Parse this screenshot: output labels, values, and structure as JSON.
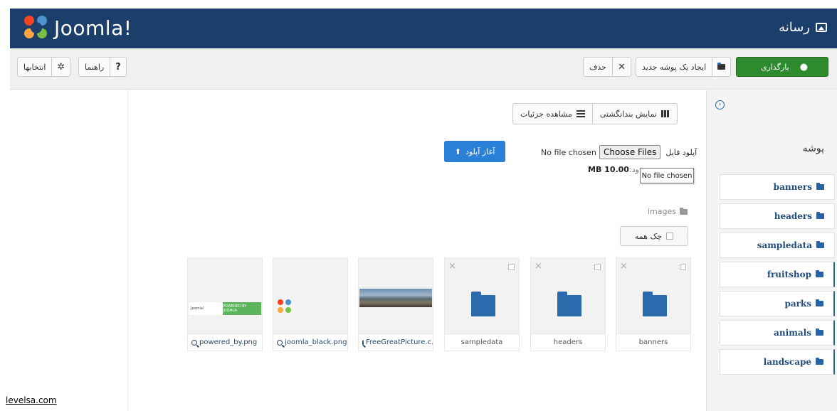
{
  "header": {
    "brand": "Joomla!",
    "page_title": "رسانه"
  },
  "toolbar": {
    "upload_label": "بارگذاری",
    "new_folder_label": "ایجاد یک پوشه جدید",
    "delete_label": "حذف",
    "help_label": "راهنما",
    "options_label": "انتخابها"
  },
  "sidebar": {
    "title": "پوشه",
    "folders": [
      {
        "label": "banners",
        "child": false
      },
      {
        "label": "headers",
        "child": false
      },
      {
        "label": "sampledata",
        "child": false
      },
      {
        "label": "fruitshop",
        "child": true
      },
      {
        "label": "parks",
        "child": true
      },
      {
        "label": "animals",
        "child": true
      },
      {
        "label": "landscape",
        "child": true
      }
    ]
  },
  "views": {
    "thumbnail_label": "نمایش بندانگشتی",
    "detail_label": "مشاهده جزئیات"
  },
  "upload": {
    "file_label": "آپلود فایل",
    "choose_button": "Choose Files",
    "no_file": "No file chosen",
    "max_size": "MB 10.00",
    "max_size_label": "ود:",
    "tooltip": "No file chosen",
    "start_button": "آغاز آپلود"
  },
  "browser": {
    "breadcrumb": "images",
    "check_all": "چک همه",
    "items": [
      {
        "type": "folder",
        "name": "banners"
      },
      {
        "type": "folder",
        "name": "headers"
      },
      {
        "type": "folder",
        "name": "sampledata"
      },
      {
        "type": "image",
        "name": "FreeGreatPicture.c..."
      },
      {
        "type": "image",
        "name": "joomla_black.png"
      },
      {
        "type": "image",
        "name": "powered_by.png"
      }
    ],
    "powered_banner_left": "Joomla!",
    "powered_banner_right": "POWERED BY JOOMLA"
  },
  "watermark": "levelsa.com",
  "colors": {
    "header_bg": "#1b3e6b",
    "upload_green": "#2d8a2d",
    "primary_blue": "#2a7fd6",
    "folder_blue": "#2a6aad"
  }
}
